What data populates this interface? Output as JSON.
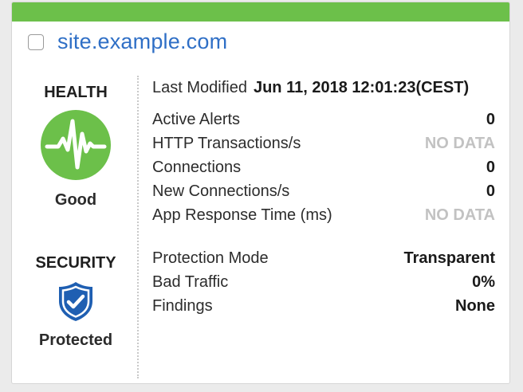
{
  "site": {
    "name": "site.example.com"
  },
  "health": {
    "title": "HEALTH",
    "status": "Good",
    "icon": "heartbeat-icon",
    "color": "#6cc04a"
  },
  "security": {
    "title": "SECURITY",
    "status": "Protected",
    "icon": "shield-check-icon",
    "color": "#1f5fb2"
  },
  "last_modified": {
    "label": "Last Modified",
    "value": "Jun 11, 2018 12:01:23(CEST)"
  },
  "health_metrics": [
    {
      "label": "Active Alerts",
      "value": "0"
    },
    {
      "label": "HTTP Transactions/s",
      "value": "NO DATA"
    },
    {
      "label": "Connections",
      "value": "0"
    },
    {
      "label": "New Connections/s",
      "value": "0"
    },
    {
      "label": "App Response Time (ms)",
      "value": "NO DATA"
    }
  ],
  "security_metrics": [
    {
      "label": "Protection Mode",
      "value": "Transparent"
    },
    {
      "label": "Bad Traffic",
      "value": "0%"
    },
    {
      "label": "Findings",
      "value": "None"
    }
  ],
  "colors": {
    "accent_bar": "#6cc04a",
    "link": "#2f6fc6",
    "nodata": "#c2c2c2"
  }
}
